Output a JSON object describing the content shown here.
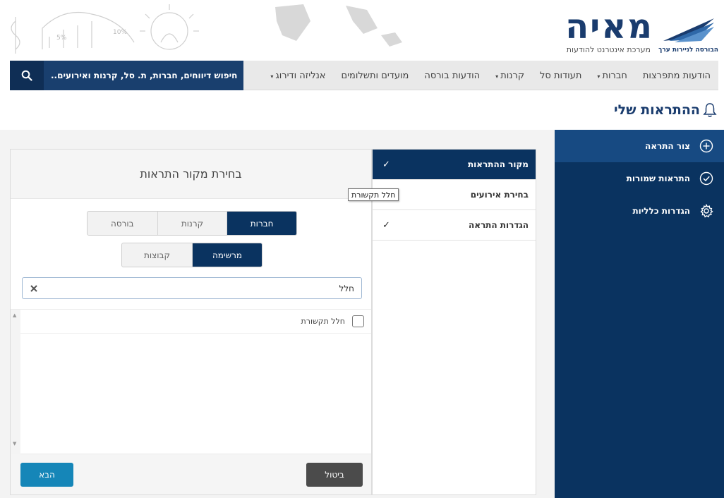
{
  "header": {
    "logo_word": "מאיה",
    "logo_subtitle": "מערכת אינטרנט להודעות",
    "logo_org": "הבורסה לניירות ערך",
    "decor_labels": [
      "5%",
      "10%"
    ]
  },
  "nav": {
    "items": [
      {
        "label": "הודעות מתפרצות",
        "dropdown": false
      },
      {
        "label": "חברות",
        "dropdown": true
      },
      {
        "label": "תעודות סל",
        "dropdown": false
      },
      {
        "label": "קרנות",
        "dropdown": true
      },
      {
        "label": "הודעות בורסה",
        "dropdown": false
      },
      {
        "label": "מועדים ותשלומים",
        "dropdown": false
      },
      {
        "label": "אנליזה ודירוג",
        "dropdown": true
      }
    ],
    "caret": "▾",
    "search_label": "חיפוש דיווחים, חברות, ת. סל, קרנות ואירועים..",
    "search_icon": "search-icon"
  },
  "page": {
    "title": "ההתראות שלי",
    "title_icon": "bell-icon"
  },
  "sidebar": {
    "items": [
      {
        "label": "צור התראה",
        "icon": "plus-circle-icon",
        "active": true
      },
      {
        "label": "התראות שמורות",
        "icon": "check-circle-icon",
        "active": false
      },
      {
        "label": "הגדרות כלליות",
        "icon": "gear-icon",
        "active": false
      }
    ]
  },
  "steps": {
    "items": [
      {
        "label": "מקור ההתראות",
        "check": "✓",
        "active": true
      },
      {
        "label": "בחירת אירועים",
        "check": "✓",
        "active": false
      },
      {
        "label": "הגדרות התראה",
        "check": "✓",
        "active": false
      }
    ]
  },
  "panel": {
    "title": "בחירת מקור התראות",
    "source_tabs": [
      "חברות",
      "קרנות",
      "בורסה"
    ],
    "source_selected": "חברות",
    "mode_tabs": [
      "מרשימה",
      "קבוצות"
    ],
    "mode_selected": "מרשימה",
    "search_value": "חלל",
    "clear_glyph": "✕",
    "results": [
      {
        "label": "חלל תקשורת",
        "checked": false
      }
    ],
    "tooltip": "חלל תקשורת",
    "scroll_up": "▲",
    "scroll_down": "▼",
    "next_label": "הבא",
    "cancel_label": "ביטול"
  },
  "colors": {
    "navy": "#0a3360",
    "accent_blue": "#1586b8",
    "cancel_gray": "#4b4b4b"
  }
}
